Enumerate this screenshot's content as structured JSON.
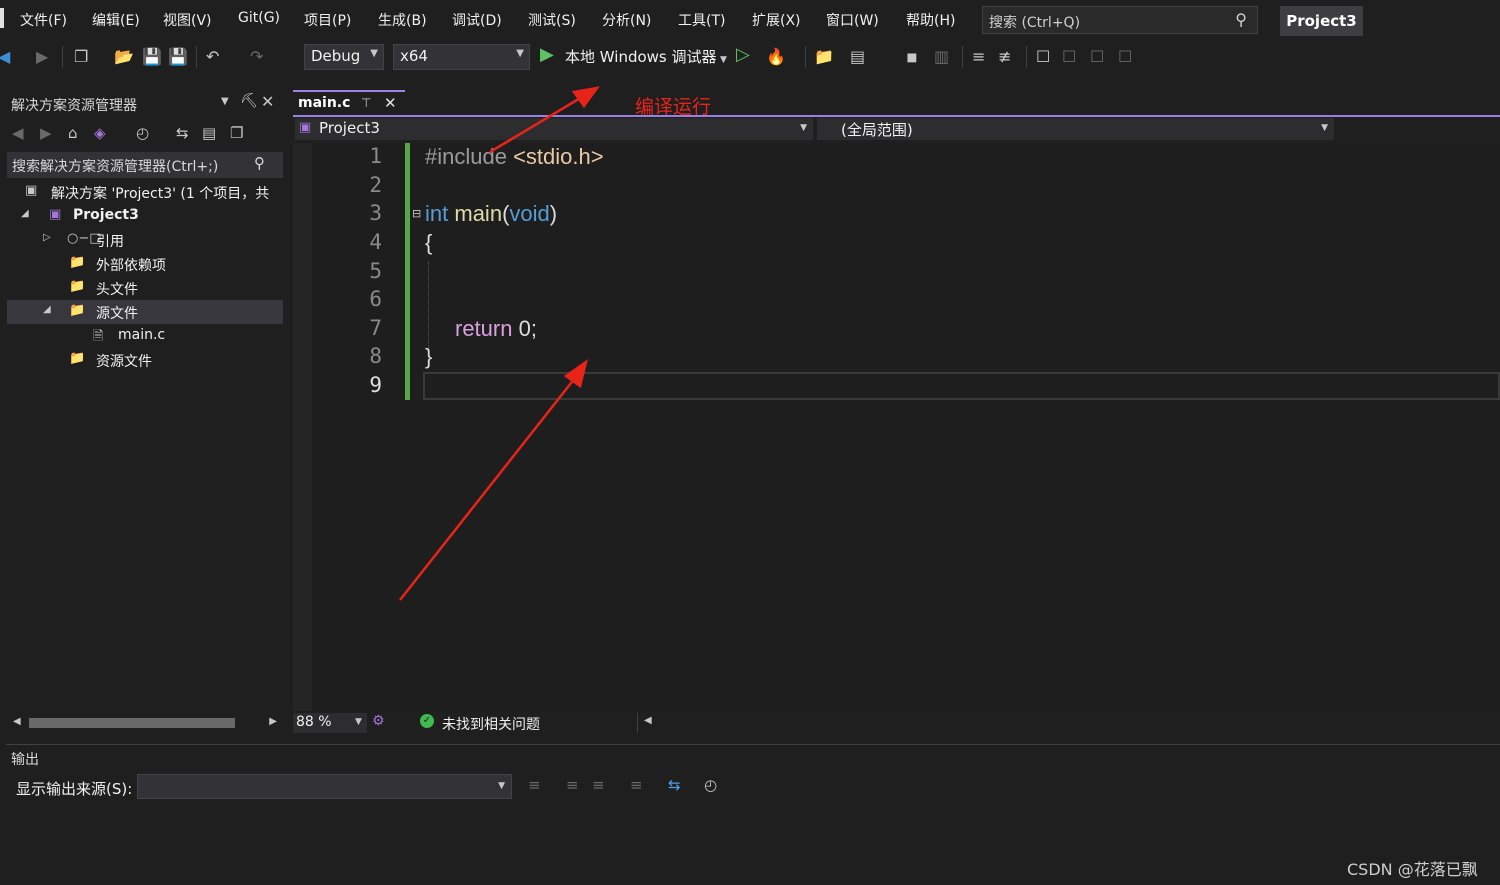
{
  "menu": {
    "items": [
      "文件(F)",
      "编辑(E)",
      "视图(V)",
      "Git(G)",
      "项目(P)",
      "生成(B)",
      "调试(D)",
      "测试(S)",
      "分析(N)",
      "工具(T)",
      "扩展(X)",
      "窗口(W)",
      "帮助(H)"
    ],
    "search_placeholder": "搜索 (Ctrl+Q)",
    "project_badge": "Project3"
  },
  "toolbar": {
    "config": "Debug",
    "platform": "x64",
    "run_label": "本地 Windows 调试器"
  },
  "solution_explorer": {
    "title": "解决方案资源管理器",
    "search_placeholder": "搜索解决方案资源管理器(Ctrl+;)",
    "tree": [
      {
        "label": "解决方案 'Project3' (1 个项目，共"
      },
      {
        "label": "Project3"
      },
      {
        "label": "引用"
      },
      {
        "label": "外部依赖项"
      },
      {
        "label": "头文件"
      },
      {
        "label": "源文件"
      },
      {
        "label": "main.c"
      },
      {
        "label": "资源文件"
      }
    ]
  },
  "editor": {
    "tab": "main.c",
    "nav_left": "Project3",
    "nav_right": "(全局范围)",
    "line_numbers": [
      "1",
      "2",
      "3",
      "4",
      "5",
      "6",
      "7",
      "8",
      "9"
    ],
    "code": {
      "l1_directive": "#include",
      "l1_header": "<stdio.h>",
      "l3_int": "int",
      "l3_main": "main",
      "l3_open": "(",
      "l3_void": "void",
      "l3_close": ")",
      "l4": "{",
      "l7_return": "return",
      "l7_rest": "0;",
      "l8": "}"
    },
    "zoom": "88 %",
    "status": "未找到相关问题"
  },
  "output": {
    "title": "输出",
    "source_label": "显示输出来源(S):"
  },
  "annotation": "编译运行",
  "watermark": "CSDN @花落已飘",
  "colors": {
    "accent": "#9a80e5",
    "change_bar": "#57a64a",
    "annotation": "#e8241a",
    "keyword": "#569cd6"
  }
}
